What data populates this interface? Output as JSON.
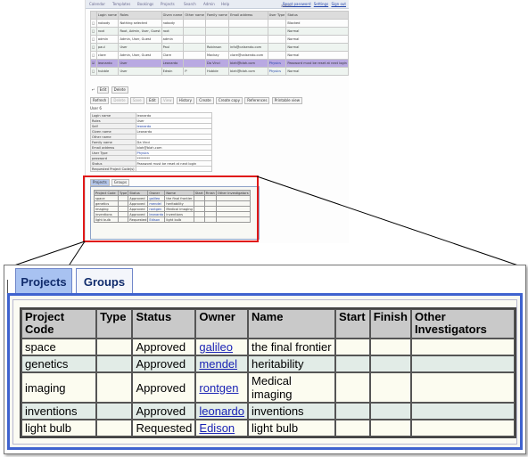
{
  "thumbnail": {
    "nav": [
      "Calendar",
      "Templates",
      "Bookings",
      "Projects",
      "Search",
      "Admin",
      "Help"
    ],
    "user_links": {
      "user": "admin",
      "reset": "Reset password",
      "settings": "Settings",
      "signout": "Sign out"
    },
    "users_table": {
      "headers": [
        "",
        "Login name",
        "Roles",
        "Given name",
        "Other name",
        "Family name",
        "Email address",
        "User Type",
        "Status"
      ],
      "rows": [
        [
          "",
          "nobody",
          "Nothing selected",
          "nobody",
          "",
          "",
          "",
          "",
          "Blocked"
        ],
        [
          "",
          "root",
          "Root, Admin, User, Guest",
          "root",
          "",
          "",
          "",
          "",
          "Normal"
        ],
        [
          "",
          "admin",
          "Admin, User, Guest",
          "admin",
          "",
          "",
          "",
          "",
          "Normal"
        ],
        [
          "",
          "paul",
          "User",
          "Paul",
          "",
          "Robinson",
          "info@calsendo.com",
          "",
          "Normal"
        ],
        [
          "",
          "clare",
          "Admin, User, Guest",
          "Clare",
          "",
          "Mackay",
          "clare@calsendo.com",
          "",
          "Normal"
        ],
        [
          "",
          "leonardo",
          "User",
          "Leonardo",
          "",
          "Da Vinci",
          "blah@blah.com",
          "Physics",
          "Password must be reset at next login"
        ],
        [
          "",
          "hubble",
          "User",
          "Edwin",
          "P",
          "Hubble",
          "blah@blah.com",
          "Physics",
          "Normal"
        ]
      ]
    },
    "user_buttons": [
      "Edit",
      "Delete"
    ],
    "detail_buttons": [
      "Refresh",
      "Delete",
      "Save",
      "Edit",
      "View",
      "History",
      "Create",
      "Create copy",
      "References",
      "Printable view"
    ],
    "user_id_label": "User 6",
    "details": [
      [
        "Login name",
        "leonardo"
      ],
      [
        "Roles",
        "User"
      ],
      [
        "Self",
        "leonardo"
      ],
      [
        "Given name",
        "Leonardo"
      ],
      [
        "Other name",
        ""
      ],
      [
        "Family name",
        "Da Vinci"
      ],
      [
        "Email address",
        "blah@blah.com"
      ],
      [
        "User Type",
        "Physics"
      ],
      [
        "password",
        "********"
      ],
      [
        "Status",
        "Password must be reset at next login"
      ],
      [
        "Requested Project Code(s)",
        ""
      ]
    ]
  },
  "zoom": {
    "tabs": [
      {
        "label": "Projects",
        "active": true
      },
      {
        "label": "Groups",
        "active": false
      }
    ],
    "table": {
      "headers": [
        "Project Code",
        "Type",
        "Status",
        "Owner",
        "Name",
        "Start",
        "Finish",
        "Other Investigators"
      ],
      "rows": [
        {
          "code": "space",
          "type": "",
          "status": "Approved",
          "owner": "galileo",
          "name": "the final frontier",
          "start": "",
          "finish": "",
          "other": ""
        },
        {
          "code": "genetics",
          "type": "",
          "status": "Approved",
          "owner": "mendel",
          "name": "heritability",
          "start": "",
          "finish": "",
          "other": ""
        },
        {
          "code": "imaging",
          "type": "",
          "status": "Approved",
          "owner": "rontgen",
          "name": "Medical imaging",
          "start": "",
          "finish": "",
          "other": ""
        },
        {
          "code": "inventions",
          "type": "",
          "status": "Approved",
          "owner": "leonardo",
          "name": "inventions",
          "start": "",
          "finish": "",
          "other": ""
        },
        {
          "code": "light bulb",
          "type": "",
          "status": "Requested",
          "owner": "Edison",
          "name": "light bulb",
          "start": "",
          "finish": "",
          "other": ""
        }
      ]
    }
  },
  "colors": {
    "highlight_box": "#e01818",
    "active_tab": "#a8c2f1",
    "panel_border": "#3f63cf",
    "link": "#1a23b4"
  }
}
